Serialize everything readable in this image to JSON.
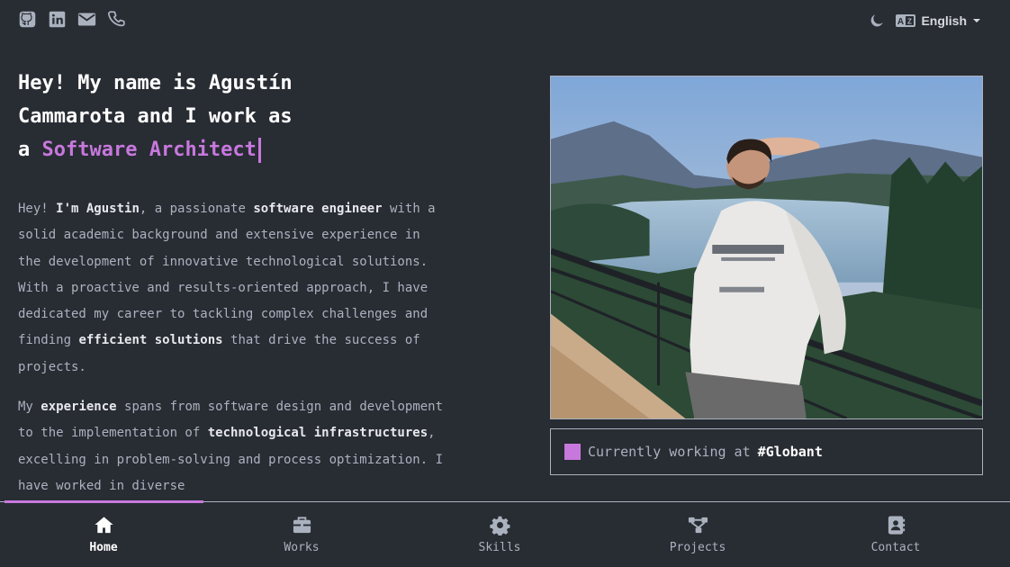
{
  "topbar": {
    "social_icons": [
      "github-icon",
      "linkedin-icon",
      "mail-icon",
      "phone-icon"
    ],
    "theme_icon": "moon-icon",
    "language_icon": "translate-icon",
    "language": "English"
  },
  "hero": {
    "line1": "Hey! My name is Agustín",
    "line2": "Cammarota and I work as",
    "line3_prefix": "a",
    "role": "Software Architect"
  },
  "about": {
    "p1": [
      {
        "t": "Hey! "
      },
      {
        "t": "I'm Agustin",
        "b": true
      },
      {
        "t": ", a passionate "
      },
      {
        "t": "software engineer",
        "b": true
      },
      {
        "t": " with a solid academic background and extensive experience in the development of innovative technological solutions. With a proactive and results-oriented approach, I have dedicated my career to tackling complex challenges and finding "
      },
      {
        "t": "efficient solutions",
        "b": true
      },
      {
        "t": " that drive the success of projects."
      }
    ],
    "p2": [
      {
        "t": "My "
      },
      {
        "t": "experience",
        "b": true
      },
      {
        "t": " spans from software design and development to the implementation of "
      },
      {
        "t": "technological infrastructures",
        "b": true
      },
      {
        "t": ", excelling in problem-solving and process optimization. I have worked in diverse"
      }
    ]
  },
  "status": {
    "prefix": "Currently working at",
    "company": "#Globant"
  },
  "nav": {
    "items": [
      {
        "label": "Home",
        "icon": "home-icon",
        "active": true
      },
      {
        "label": "Works",
        "icon": "briefcase-icon"
      },
      {
        "label": "Skills",
        "icon": "gear-icon"
      },
      {
        "label": "Projects",
        "icon": "network-icon"
      },
      {
        "label": "Contact",
        "icon": "contact-card-icon"
      }
    ]
  },
  "colors": {
    "background": "#282c33",
    "accent": "#c778dd",
    "text": "#abb2bf",
    "heading": "#ffffff"
  }
}
